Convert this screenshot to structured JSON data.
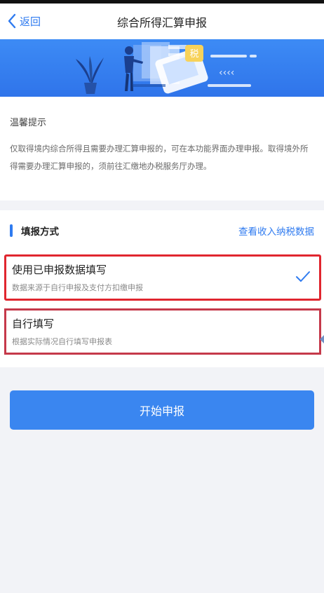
{
  "header": {
    "back_label": "返回",
    "title": "综合所得汇算申报"
  },
  "banner": {
    "tax_char": "税",
    "arrows": "‹‹‹‹"
  },
  "tips": {
    "title": "温馨提示",
    "body": "仅取得境内综合所得且需要办理汇算申报的，可在本功能界面办理申报。取得境外所得需要办理汇算申报的，须前往汇缴地办税服务厅办理。"
  },
  "method": {
    "section_title": "填报方式",
    "view_data_link": "查看收入纳税数据",
    "options": [
      {
        "title": "使用已申报数据填写",
        "subtitle": "数据来源于自行申报及支付方扣缴申报",
        "selected": true
      },
      {
        "title": "自行填写",
        "subtitle": "根据实际情况自行填写申报表",
        "selected": false
      }
    ]
  },
  "actions": {
    "start_label": "开始申报"
  },
  "colors": {
    "accent": "#2f7bf0",
    "highlight_red": "#e0262f",
    "highlight_dark_red": "#c5394a",
    "background": "#f2f3f7"
  }
}
